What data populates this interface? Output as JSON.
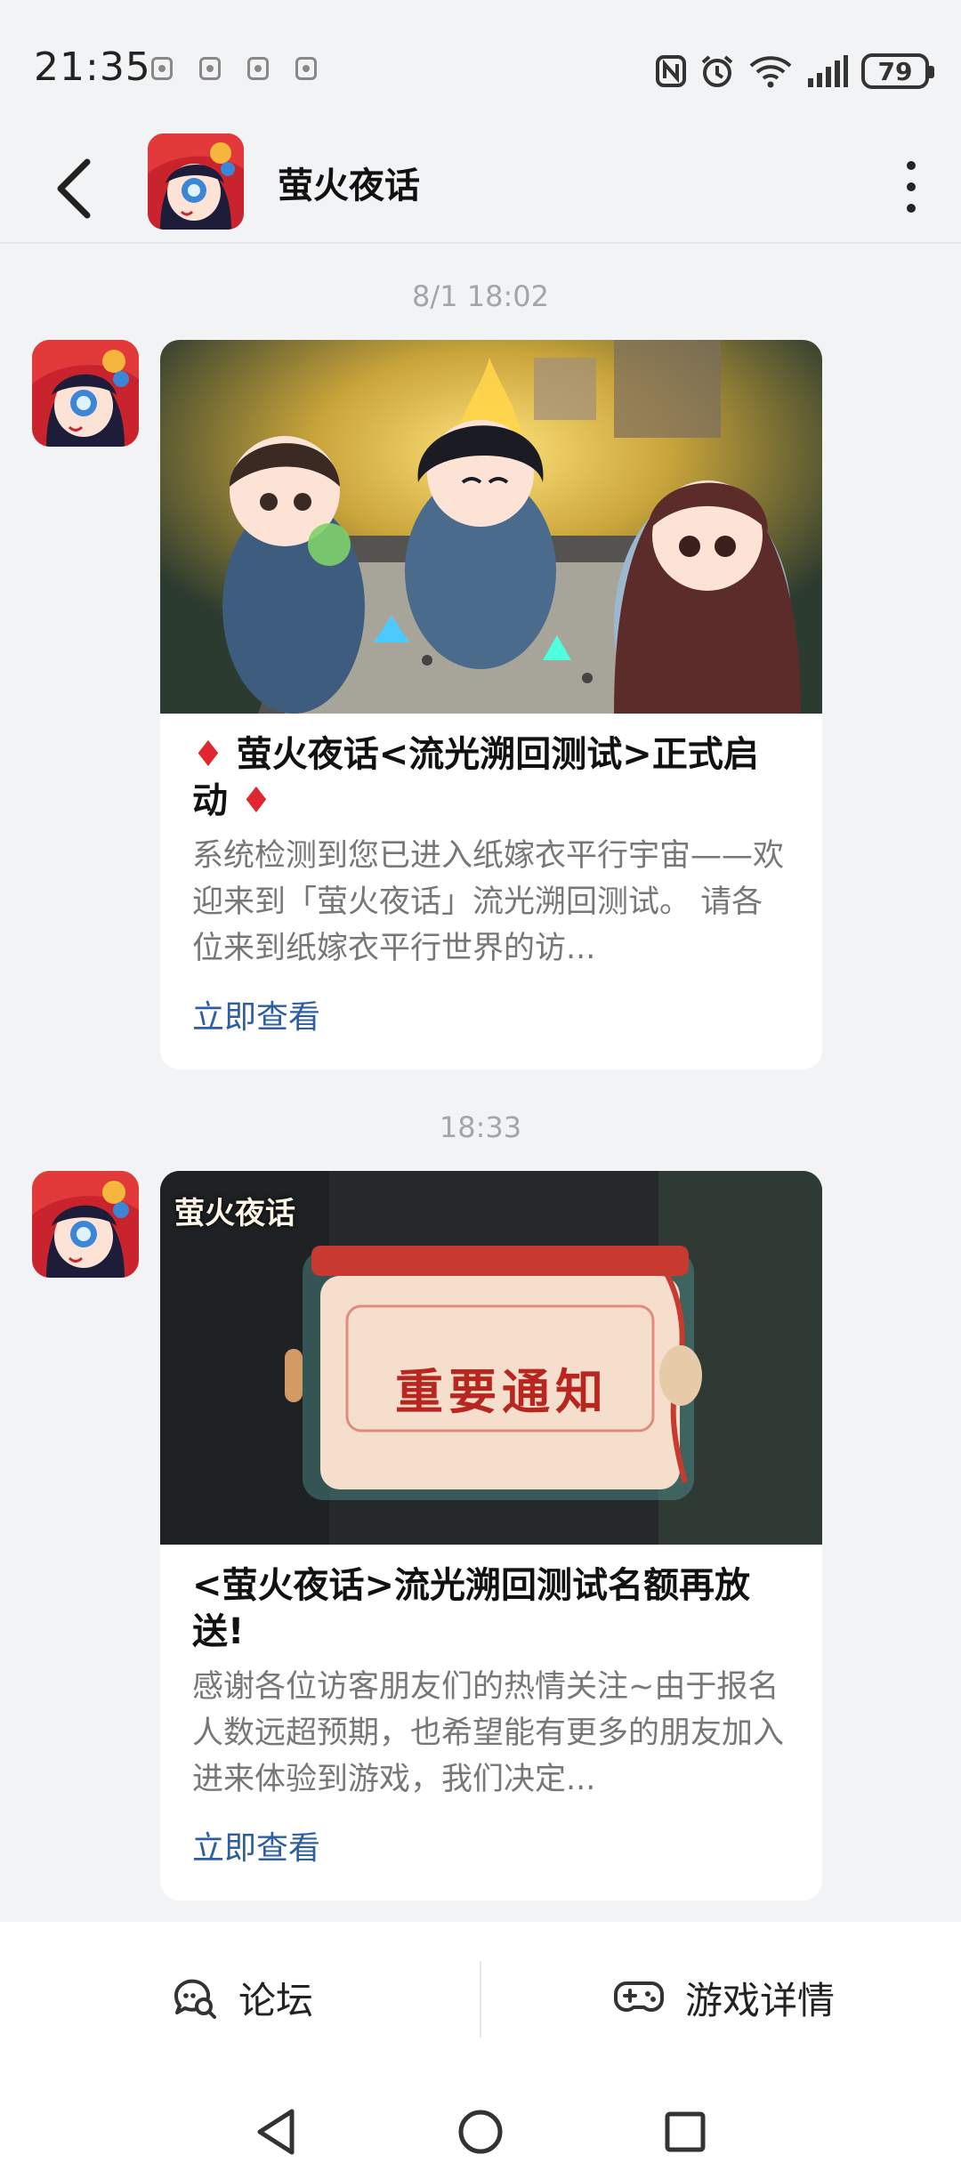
{
  "status_bar": {
    "time": "21:35",
    "battery": "79",
    "icons": [
      "nfc-icon",
      "alarm-icon",
      "wifi-icon",
      "signal-icon",
      "battery-icon"
    ],
    "notification_icons": [
      "app-notification-icon",
      "app-notification-icon",
      "camera-notification-icon",
      "app-notification-icon"
    ]
  },
  "header": {
    "title": "萤火夜话",
    "back_icon": "back-arrow-icon",
    "more_icon": "more-vertical-icon"
  },
  "messages": [
    {
      "timestamp": "8/1  18:02",
      "title": "♦ 萤火夜话<流光溯回测试>正式启动 ♦",
      "description": "系统检测到您已进入纸嫁衣平行宇宙——欢迎来到「萤火夜话」流光溯回测试。 请各位来到纸嫁衣平行世界的访...",
      "link": "立即查看"
    },
    {
      "timestamp": "18:33",
      "image_logo": "萤火夜话",
      "image_banner": "重要通知",
      "title": "<萤火夜话>流光溯回测试名额再放送!",
      "description": "感谢各位访客朋友们的热情关注~由于报名人数远超预期，也希望能有更多的朋友加入进来体验到游戏，我们决定...",
      "link": "立即查看"
    }
  ],
  "bottom_bar": {
    "forum_label": "论坛",
    "forum_icon": "forum-chat-icon",
    "game_label": "游戏详情",
    "game_icon": "gamepad-icon"
  },
  "colors": {
    "background": "#f2f3f5",
    "link": "#2d5ea1",
    "timestamp": "#a2a5ab",
    "diamond": "#e0262f"
  }
}
